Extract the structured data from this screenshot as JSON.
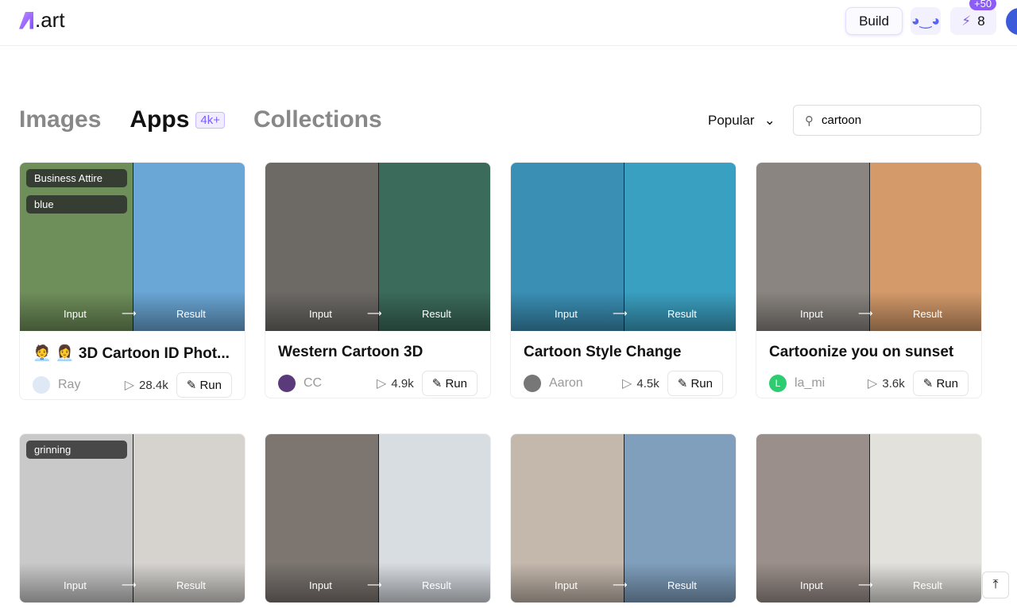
{
  "header": {
    "logo": ".art",
    "build": "Build",
    "credits": "8",
    "credits_bonus": "+50"
  },
  "tabs": [
    {
      "label": "Images"
    },
    {
      "label": "Apps",
      "badge": "4k+"
    },
    {
      "label": "Collections"
    }
  ],
  "sort": {
    "selected": "Popular"
  },
  "search": {
    "value": "cartoon"
  },
  "image_labels": {
    "input": "Input",
    "result": "Result",
    "arrow": "⟶"
  },
  "cards": [
    {
      "title": "🧑‍💼 👩‍💼 3D Cartoon ID Phot...",
      "author": "Ray",
      "plays": "28.4k",
      "run": "Run",
      "tags": [
        "Business Attire",
        "blue"
      ],
      "colors": [
        "#6f8f5a",
        "#6aa6d6"
      ],
      "avatar": "#dfe8f5"
    },
    {
      "title": "Western Cartoon 3D",
      "author": "CC",
      "plays": "4.9k",
      "run": "Run",
      "tags": [],
      "colors": [
        "#6d6a66",
        "#3b6b5a"
      ],
      "avatar": "#5a3a7a"
    },
    {
      "title": "Cartoon Style Change",
      "author": "Aaron",
      "plays": "4.5k",
      "run": "Run",
      "tags": [],
      "colors": [
        "#3a8fb5",
        "#3aa0c2"
      ],
      "avatar": "#777"
    },
    {
      "title": "Cartoonize you on sunset",
      "author": "la_mi",
      "plays": "3.6k",
      "run": "Run",
      "tags": [],
      "colors": [
        "#8a8580",
        "#d49a6a"
      ],
      "avatar": "#2ecc71",
      "avatar_letter": "L"
    },
    {
      "tags": [
        "grinning"
      ],
      "colors": [
        "#c9c9c9",
        "#d6d3cf"
      ]
    },
    {
      "tags": [],
      "colors": [
        "#7c7570",
        "#d8dde2"
      ]
    },
    {
      "tags": [],
      "colors": [
        "#c4b8ad",
        "#7f9fbd"
      ]
    },
    {
      "tags": [],
      "colors": [
        "#9a8f8a",
        "#e3e1dc"
      ]
    }
  ]
}
